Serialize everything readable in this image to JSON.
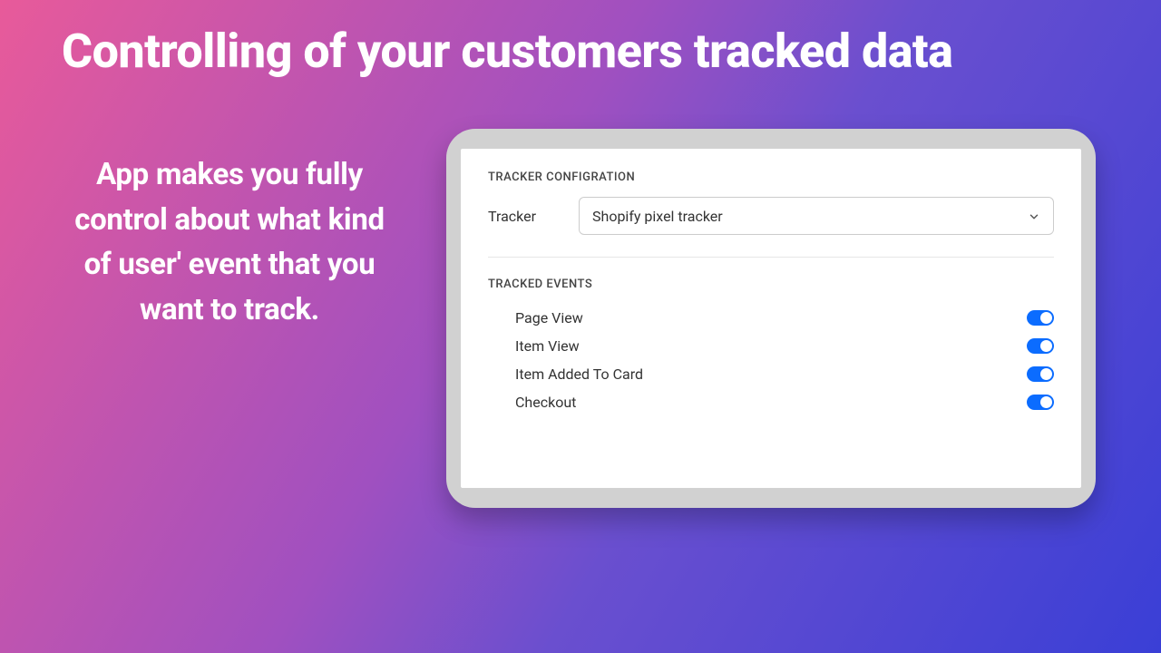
{
  "hero": {
    "title": "Controlling of your customers tracked data",
    "subtitle": "App makes you fully control about what kind of user' event that you want to track."
  },
  "panel": {
    "tracker_section_title": "TRACKER CONFIGRATION",
    "tracker_label": "Tracker",
    "tracker_value": "Shopify pixel tracker",
    "events_section_title": "TRACKED EVENTS",
    "events": [
      {
        "label": "Page View",
        "on": true
      },
      {
        "label": "Item View",
        "on": true
      },
      {
        "label": "Item Added To Card",
        "on": true
      },
      {
        "label": "Checkout",
        "on": true
      }
    ]
  }
}
